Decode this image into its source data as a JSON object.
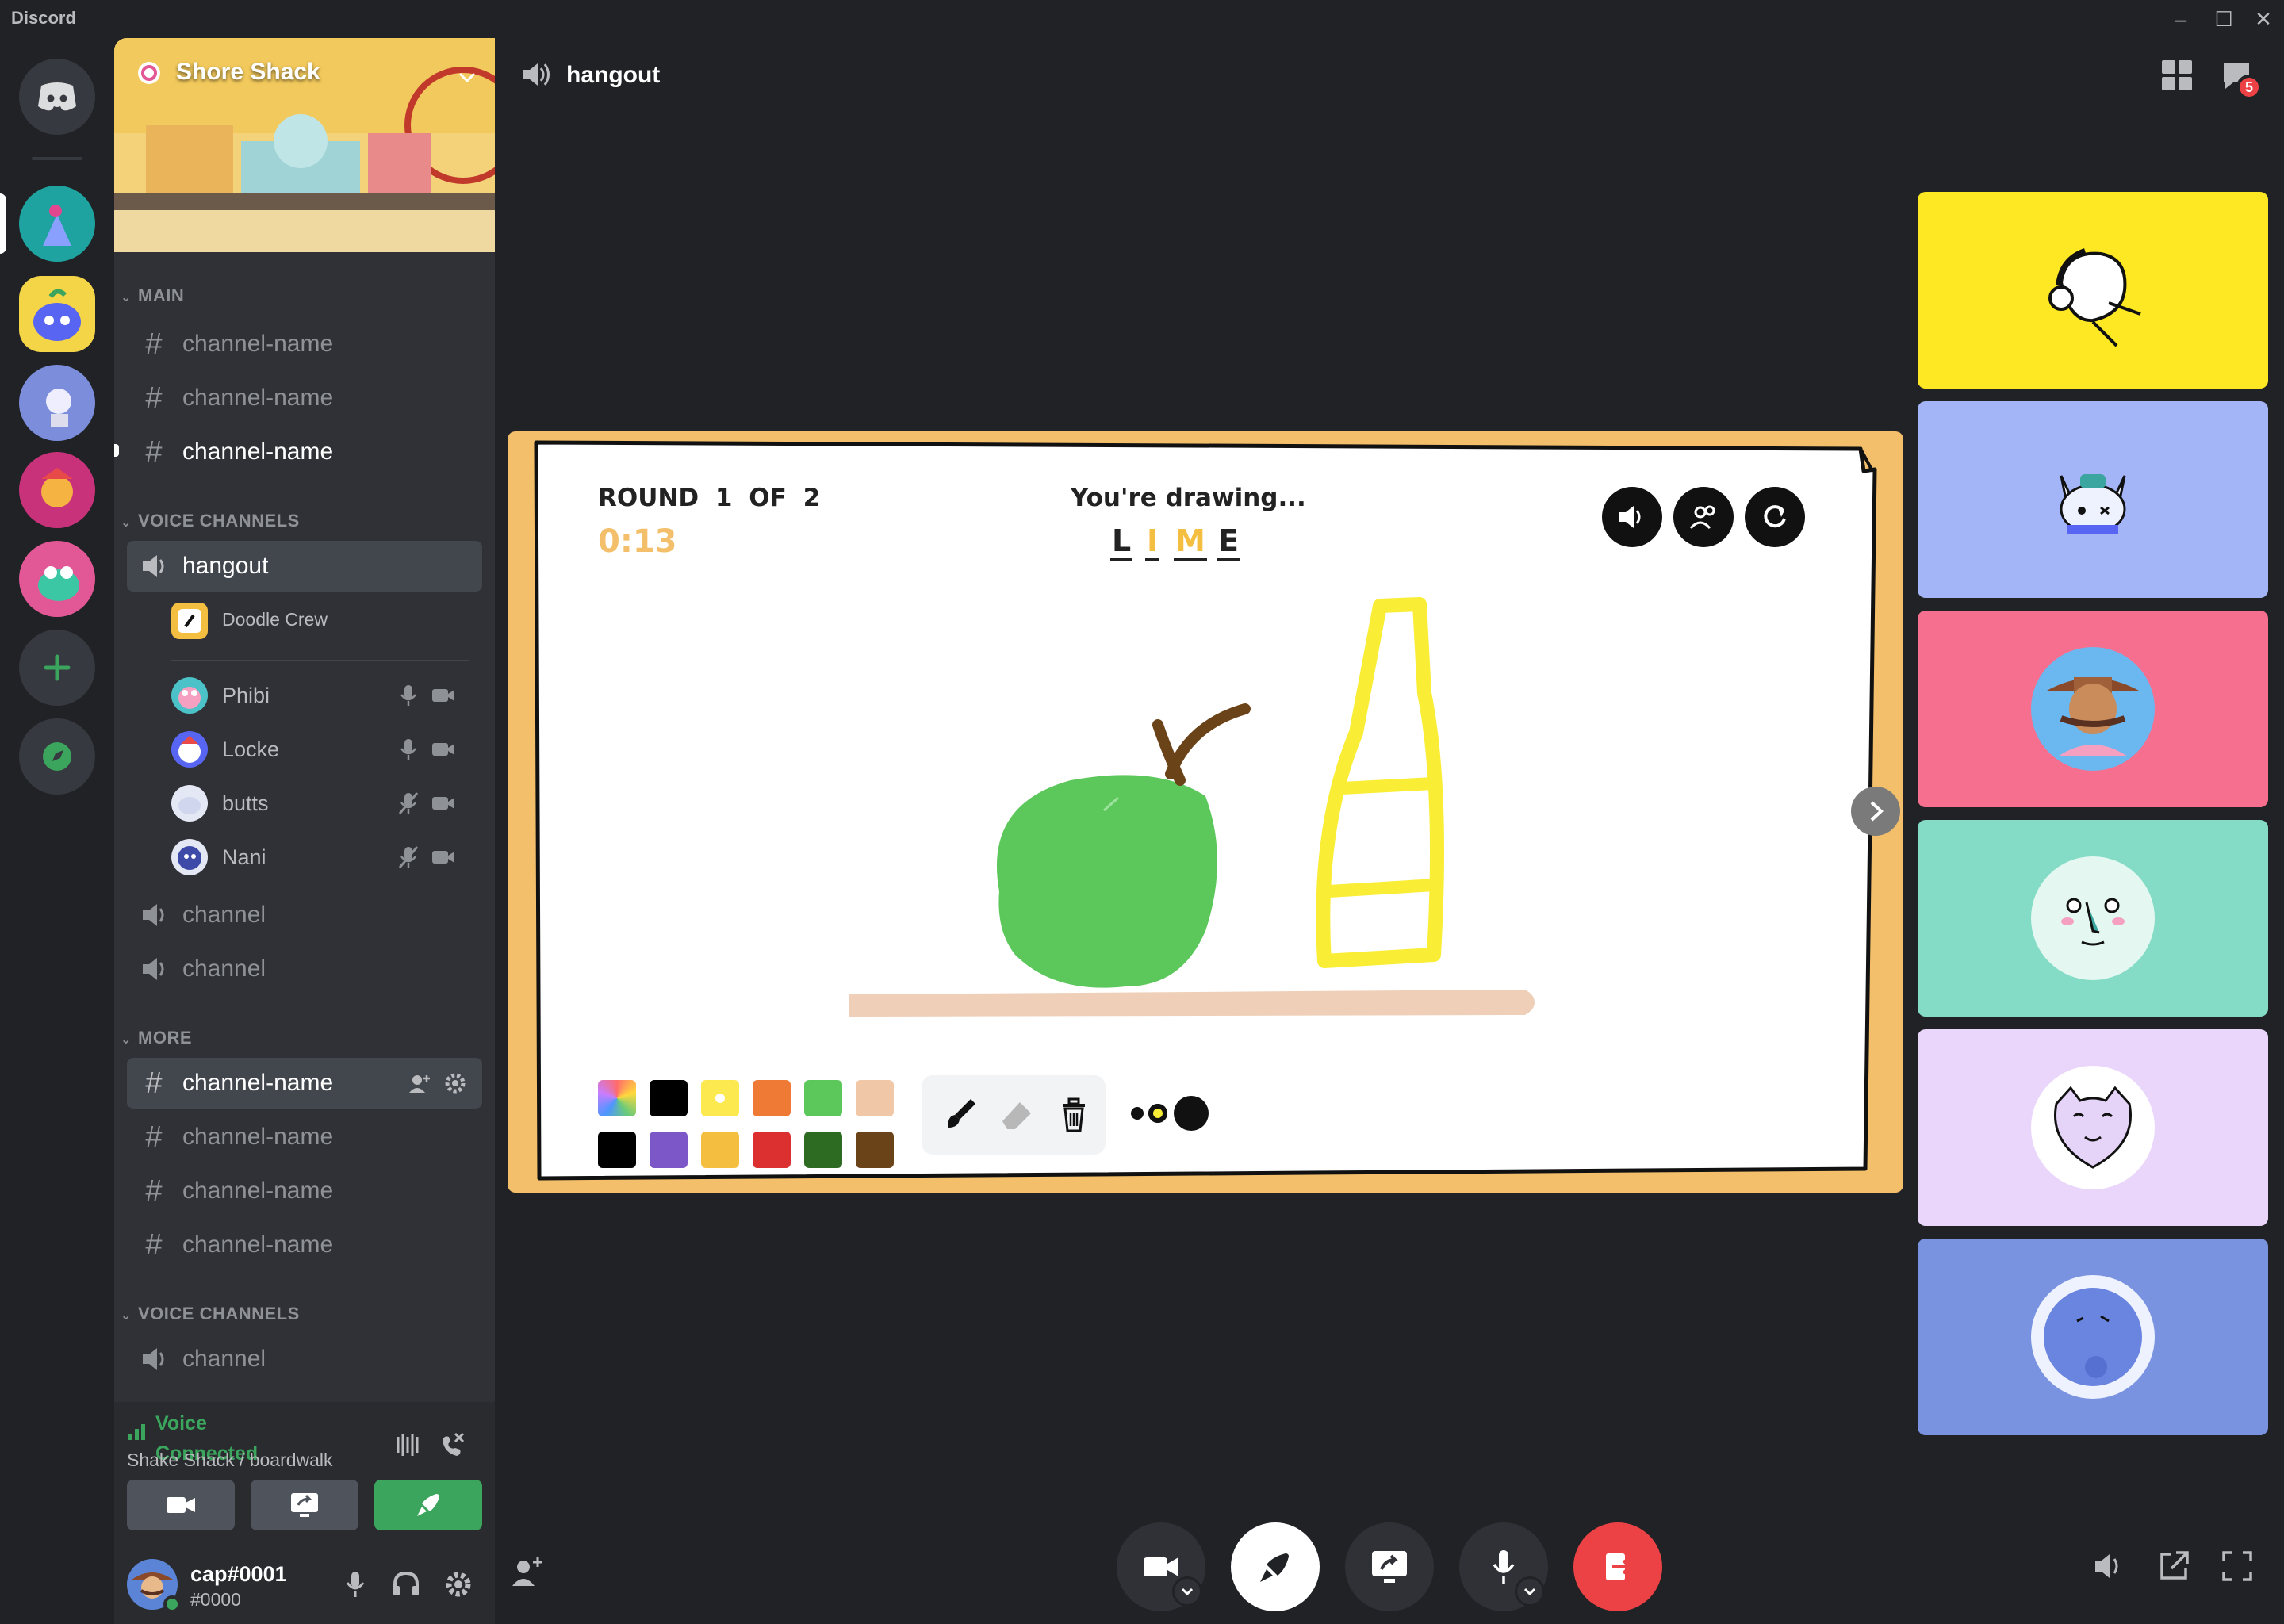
{
  "app": {
    "title": "Discord"
  },
  "server": {
    "name": "Shore Shack"
  },
  "sidebar": {
    "categories": [
      {
        "name": "MAIN",
        "channels": [
          "channel-name",
          "channel-name",
          "channel-name"
        ]
      },
      {
        "name": "VOICE CHANNELS",
        "channels": [
          "hangout",
          "channel",
          "channel"
        ]
      },
      {
        "name": "MORE",
        "channels": [
          "channel-name",
          "channel-name",
          "channel-name",
          "channel-name"
        ]
      },
      {
        "name": "VOICE CHANNELS",
        "channels": [
          "channel"
        ]
      }
    ],
    "activity": {
      "name": "Doodle Crew"
    },
    "voice_users": [
      {
        "name": "Phibi",
        "muted": false
      },
      {
        "name": "Locke",
        "muted": false
      },
      {
        "name": "butts",
        "muted": true
      },
      {
        "name": "Nani",
        "muted": true
      }
    ]
  },
  "voice_status": {
    "status": "Voice Connected",
    "location": "Shake Shack / boardwalk"
  },
  "user": {
    "name": "cap#0001",
    "tag": "#0000"
  },
  "header": {
    "channel_name": "hangout",
    "notification_count": "5"
  },
  "game": {
    "round_label": "ROUND",
    "round_current": "1",
    "round_of": "OF",
    "round_total": "2",
    "timer": "0:13",
    "prompt": "You're drawing...",
    "word_letters": [
      "L",
      "I",
      "M",
      "E"
    ],
    "palette_top": [
      "rainbow",
      "#000000",
      "#fce94f",
      "#ef7a35",
      "#5cc85c",
      "#f0c8a8"
    ],
    "palette_bottom": [
      "#000000",
      "#7b57c7",
      "#f4bf40",
      "#dc3030",
      "#2e6b22",
      "#6b4318"
    ]
  },
  "participant_tiles": [
    {
      "name": "tile-yellow",
      "color": "#fde823"
    },
    {
      "name": "tile-lavender",
      "color": "#a3b5f7"
    },
    {
      "name": "tile-pink",
      "color": "#f76f8e"
    },
    {
      "name": "tile-teal",
      "color": "#84dcc6"
    },
    {
      "name": "tile-lilac",
      "color": "#ead6fb"
    },
    {
      "name": "tile-periwinkle",
      "color": "#7a93e0"
    }
  ],
  "colors": {
    "accent_green": "#3ba55d",
    "danger_red": "#ed4245",
    "blurple": "#5865f2"
  }
}
